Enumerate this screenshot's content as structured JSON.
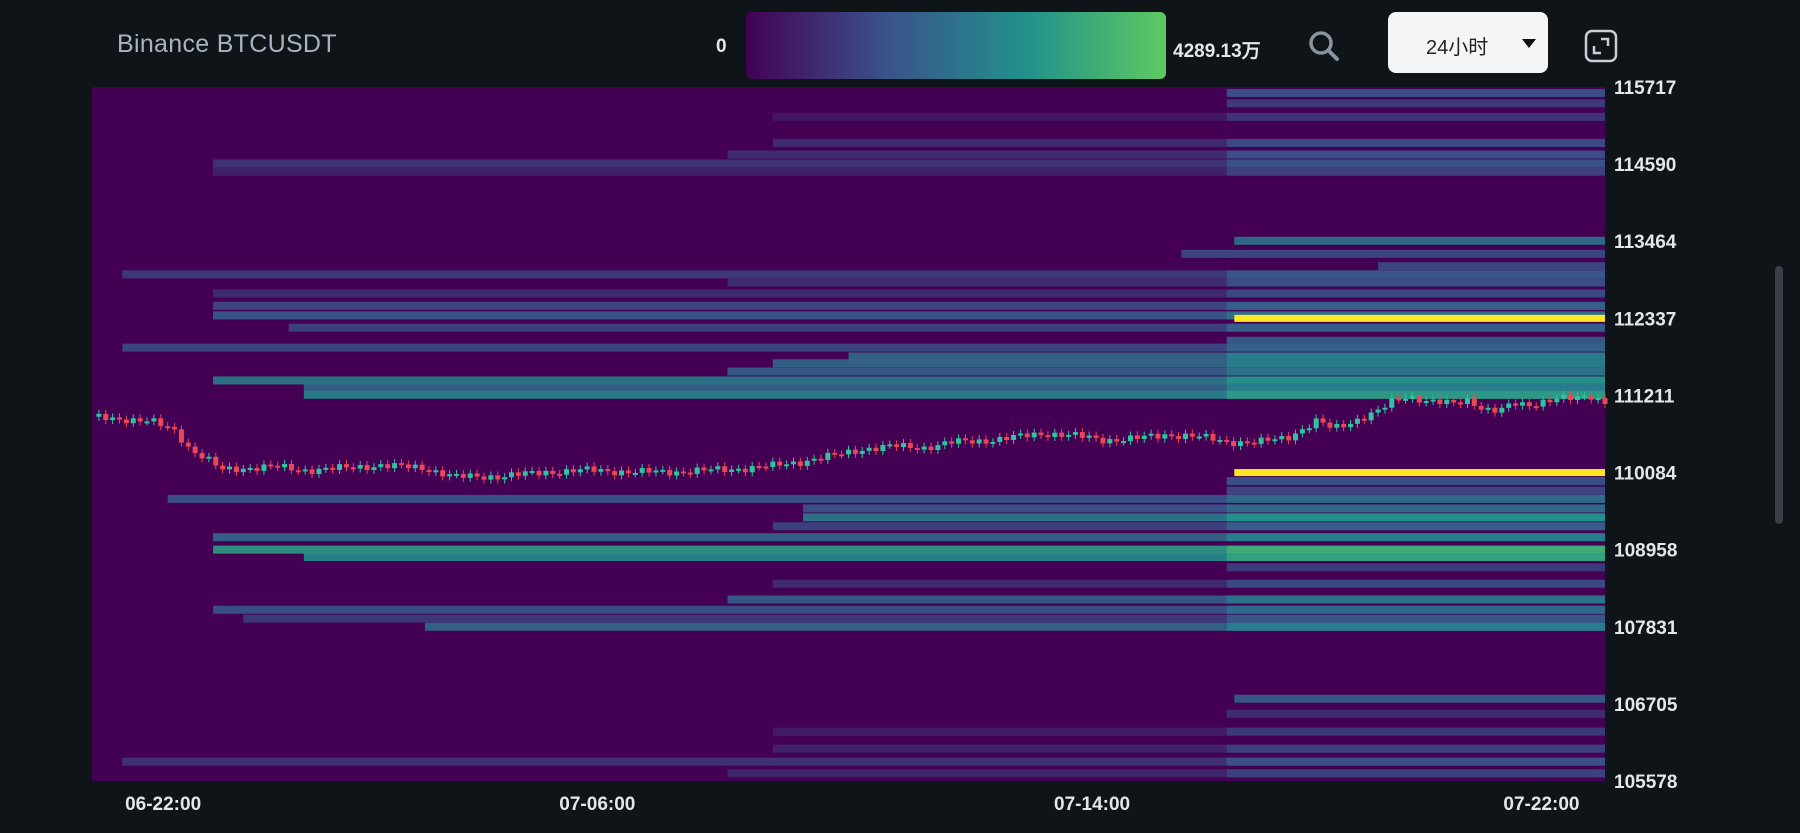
{
  "header": {
    "title": "Binance BTCUSDT",
    "scale_min": "0",
    "scale_max": "4289.13万",
    "range_label": "24小时"
  },
  "icons": {
    "search": "search-icon",
    "dropdown": "chevron-down-icon",
    "fullscreen": "fullscreen-icon"
  },
  "colors": {
    "background": "#0f1419",
    "heatmap_base": "#440154",
    "up_candle": "#2ec4a0",
    "down_candle": "#e84855",
    "hot_level": "#fde725"
  },
  "chart_data": {
    "type": "heatmap",
    "y_ticks": [
      115717,
      114590,
      113464,
      112337,
      111211,
      110084,
      108958,
      107831,
      106705,
      105578
    ],
    "ylim": [
      105578,
      115717
    ],
    "x_ticks": [
      "06-22:00",
      "07-06:00",
      "07-14:00",
      "07-22:00"
    ],
    "color_scale": {
      "min": 0,
      "max_label": "4289.13万",
      "colors": [
        "#440154",
        "#3b528b",
        "#21918c",
        "#5ec962"
      ]
    },
    "liquidity_levels": [
      {
        "price": 115630,
        "start": 0.75,
        "intensity": 0.35
      },
      {
        "price": 115480,
        "start": 0.75,
        "intensity": 0.25
      },
      {
        "price": 115280,
        "start": 0.45,
        "intensity": 0.1
      },
      {
        "price": 114900,
        "start": 0.45,
        "intensity": 0.18
      },
      {
        "price": 114730,
        "start": 0.42,
        "intensity": 0.2
      },
      {
        "price": 114600,
        "start": 0.08,
        "intensity": 0.22
      },
      {
        "price": 114480,
        "start": 0.08,
        "intensity": 0.15
      },
      {
        "price": 113470,
        "start": 0.755,
        "intensity": 0.5
      },
      {
        "price": 113280,
        "start": 0.72,
        "intensity": 0.3
      },
      {
        "price": 113100,
        "start": 0.85,
        "intensity": 0.3
      },
      {
        "price": 112980,
        "start": 0.02,
        "intensity": 0.25
      },
      {
        "price": 112860,
        "start": 0.42,
        "intensity": 0.2
      },
      {
        "price": 112700,
        "start": 0.08,
        "intensity": 0.18
      },
      {
        "price": 112520,
        "start": 0.08,
        "intensity": 0.3
      },
      {
        "price": 112380,
        "start": 0.08,
        "intensity": 0.38
      },
      {
        "price": 112337,
        "start": 0.755,
        "intensity": 1.0,
        "hot": true
      },
      {
        "price": 112200,
        "start": 0.13,
        "intensity": 0.28
      },
      {
        "price": 112010,
        "start": 0.75,
        "intensity": 0.4
      },
      {
        "price": 111910,
        "start": 0.02,
        "intensity": 0.3
      },
      {
        "price": 111780,
        "start": 0.5,
        "intensity": 0.45
      },
      {
        "price": 111680,
        "start": 0.45,
        "intensity": 0.45
      },
      {
        "price": 111560,
        "start": 0.42,
        "intensity": 0.4
      },
      {
        "price": 111430,
        "start": 0.08,
        "intensity": 0.55
      },
      {
        "price": 111330,
        "start": 0.14,
        "intensity": 0.45
      },
      {
        "price": 111220,
        "start": 0.14,
        "intensity": 0.6
      },
      {
        "price": 110084,
        "start": 0.755,
        "intensity": 1.0,
        "hot": true
      },
      {
        "price": 109960,
        "start": 0.75,
        "intensity": 0.35
      },
      {
        "price": 109820,
        "start": 0.75,
        "intensity": 0.3
      },
      {
        "price": 109700,
        "start": 0.05,
        "intensity": 0.35
      },
      {
        "price": 109560,
        "start": 0.47,
        "intensity": 0.35
      },
      {
        "price": 109430,
        "start": 0.47,
        "intensity": 0.55
      },
      {
        "price": 109300,
        "start": 0.45,
        "intensity": 0.28
      },
      {
        "price": 109140,
        "start": 0.08,
        "intensity": 0.45
      },
      {
        "price": 108958,
        "start": 0.08,
        "intensity": 0.72
      },
      {
        "price": 108850,
        "start": 0.14,
        "intensity": 0.65
      },
      {
        "price": 108700,
        "start": 0.75,
        "intensity": 0.25
      },
      {
        "price": 108460,
        "start": 0.45,
        "intensity": 0.18
      },
      {
        "price": 108230,
        "start": 0.42,
        "intensity": 0.4
      },
      {
        "price": 108080,
        "start": 0.08,
        "intensity": 0.35
      },
      {
        "price": 107950,
        "start": 0.1,
        "intensity": 0.25
      },
      {
        "price": 107831,
        "start": 0.22,
        "intensity": 0.45
      },
      {
        "price": 106780,
        "start": 0.755,
        "intensity": 0.4
      },
      {
        "price": 106560,
        "start": 0.75,
        "intensity": 0.2
      },
      {
        "price": 106300,
        "start": 0.45,
        "intensity": 0.12
      },
      {
        "price": 106050,
        "start": 0.45,
        "intensity": 0.15
      },
      {
        "price": 105860,
        "start": 0.02,
        "intensity": 0.22
      },
      {
        "price": 105690,
        "start": 0.42,
        "intensity": 0.16
      }
    ],
    "price_path": [
      [
        0.0,
        110900
      ],
      [
        0.02,
        110870
      ],
      [
        0.04,
        110820
      ],
      [
        0.055,
        110700
      ],
      [
        0.065,
        110420
      ],
      [
        0.08,
        110220
      ],
      [
        0.085,
        110120
      ],
      [
        0.1,
        110150
      ],
      [
        0.12,
        110170
      ],
      [
        0.14,
        110120
      ],
      [
        0.16,
        110140
      ],
      [
        0.19,
        110190
      ],
      [
        0.22,
        110150
      ],
      [
        0.24,
        110020
      ],
      [
        0.27,
        110030
      ],
      [
        0.3,
        110090
      ],
      [
        0.33,
        110120
      ],
      [
        0.36,
        110090
      ],
      [
        0.39,
        110100
      ],
      [
        0.42,
        110130
      ],
      [
        0.45,
        110180
      ],
      [
        0.47,
        110250
      ],
      [
        0.49,
        110330
      ],
      [
        0.51,
        110430
      ],
      [
        0.53,
        110470
      ],
      [
        0.55,
        110450
      ],
      [
        0.57,
        110530
      ],
      [
        0.59,
        110550
      ],
      [
        0.61,
        110600
      ],
      [
        0.63,
        110660
      ],
      [
        0.65,
        110620
      ],
      [
        0.67,
        110560
      ],
      [
        0.69,
        110580
      ],
      [
        0.71,
        110640
      ],
      [
        0.73,
        110610
      ],
      [
        0.75,
        110540
      ],
      [
        0.77,
        110520
      ],
      [
        0.79,
        110600
      ],
      [
        0.8,
        110720
      ],
      [
        0.81,
        110840
      ],
      [
        0.82,
        110720
      ],
      [
        0.83,
        110800
      ],
      [
        0.84,
        110900
      ],
      [
        0.85,
        110980
      ],
      [
        0.86,
        111120
      ],
      [
        0.87,
        111200
      ],
      [
        0.88,
        111150
      ],
      [
        0.9,
        111080
      ],
      [
        0.91,
        111140
      ],
      [
        0.92,
        111020
      ],
      [
        0.93,
        110990
      ],
      [
        0.94,
        111080
      ],
      [
        0.95,
        111060
      ],
      [
        0.96,
        111140
      ],
      [
        0.97,
        111180
      ],
      [
        0.98,
        111150
      ],
      [
        0.99,
        111200
      ],
      [
        1.0,
        111120
      ]
    ]
  }
}
